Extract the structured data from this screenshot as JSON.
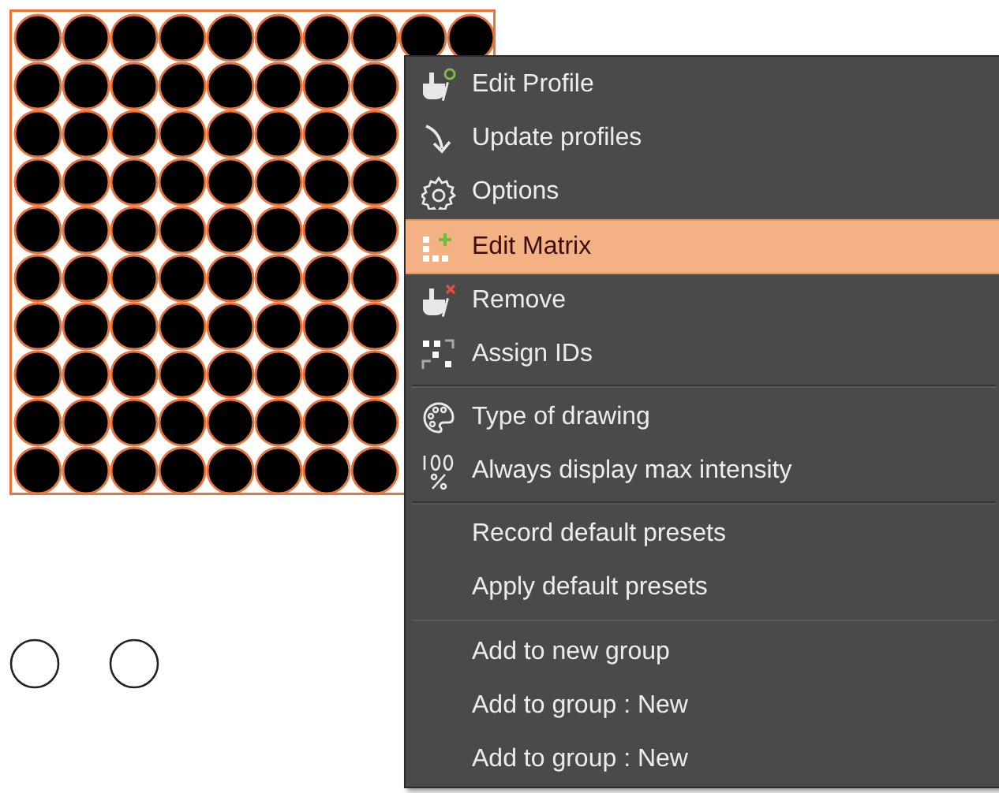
{
  "context_menu": {
    "sections": [
      {
        "items": [
          {
            "label": "Edit Profile",
            "selected": false
          },
          {
            "label": "Update profiles",
            "selected": false
          },
          {
            "label": "Options",
            "selected": false
          },
          {
            "label": "Edit Matrix",
            "selected": true
          },
          {
            "label": "Remove",
            "selected": false
          },
          {
            "label": "Assign IDs",
            "selected": false
          }
        ]
      },
      {
        "items": [
          {
            "label": "Type of drawing",
            "selected": false
          },
          {
            "label": "Always display max intensity",
            "selected": false
          }
        ]
      },
      {
        "items": [
          {
            "label": "Record default presets",
            "selected": false
          },
          {
            "label": "Apply default presets",
            "selected": false
          }
        ]
      },
      {
        "items": [
          {
            "label": "Add to new group",
            "selected": false
          },
          {
            "label": "Add to group : New",
            "selected": false
          },
          {
            "label": "Add to group : New",
            "selected": false
          }
        ]
      }
    ]
  }
}
